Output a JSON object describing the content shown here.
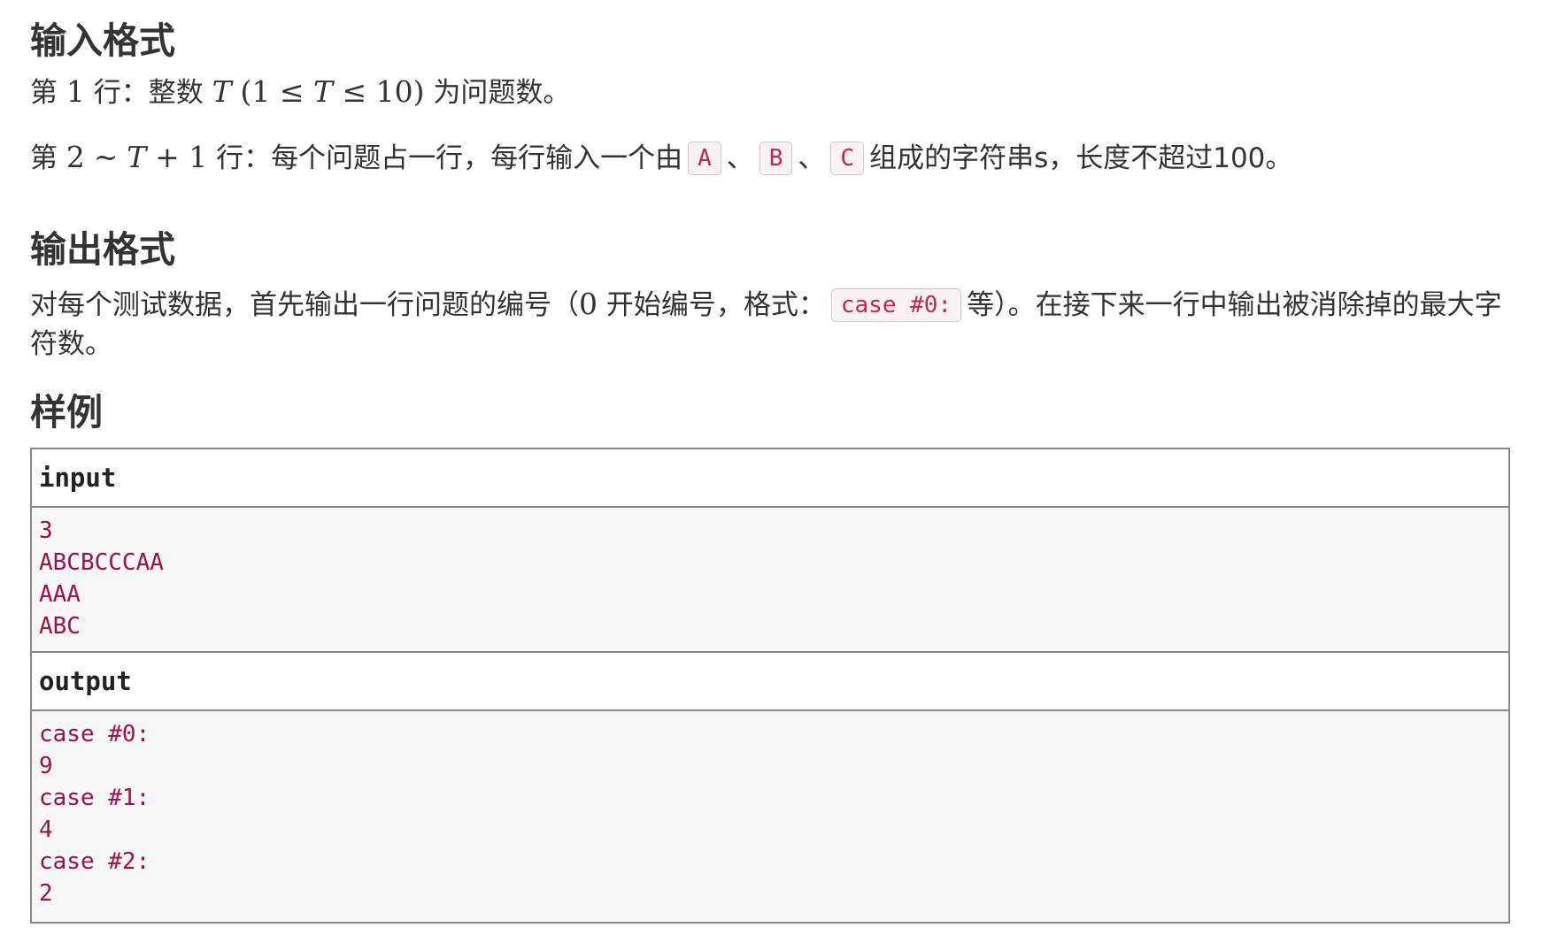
{
  "input_section": {
    "title": "输入格式",
    "line1": {
      "prefix": "第",
      "line_num": "1",
      "mid": "行：整数",
      "var": "T",
      "range_open": "(1 ≤ ",
      "range_var": "T",
      "range_close": " ≤ 10)",
      "suffix": "为问题数。"
    },
    "line2": {
      "prefix": "第",
      "range_start": "2",
      "tilde": "~",
      "var": "T",
      "plus": "+ 1",
      "mid": "行：每个问题占一行，每行输入一个由",
      "chars": [
        "A",
        "B",
        "C"
      ],
      "sep": "、",
      "suffix": "组成的字符串s，长度不超过100。"
    }
  },
  "output_section": {
    "title": "输出格式",
    "text_before": "对每个测试数据，首先输出一行问题的编号（",
    "zero": "0",
    "text_mid": "开始编号，格式：",
    "code": "case #0:",
    "text_after": "等）。在接下来一行中输出被消除掉的最大字符数。"
  },
  "sample_section": {
    "title": "样例",
    "input_label": "input",
    "input_lines": [
      "3",
      "ABCBCCCAA",
      "AAA",
      "ABC"
    ],
    "output_label": "output",
    "output_lines": [
      "case #0:",
      "9",
      "case #1:",
      "4",
      "case #2:",
      "2"
    ]
  }
}
